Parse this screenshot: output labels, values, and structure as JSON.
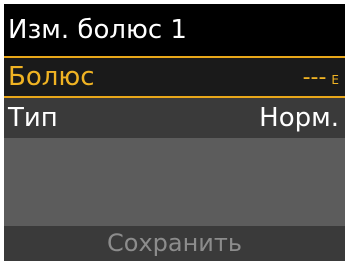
{
  "header": {
    "title": "Изм. болюс 1"
  },
  "rows": [
    {
      "label": "Болюс",
      "value": "---",
      "unit": "Е",
      "selected": true
    },
    {
      "label": "Тип",
      "value": "Норм.",
      "selected": false
    }
  ],
  "footer": {
    "save_label": "Сохранить",
    "enabled": false
  },
  "colors": {
    "accent": "#f0b323",
    "header_bg": "#000000",
    "row_bg": "#3a3a3a",
    "screen_bg": "#5c5c5c",
    "disabled_text": "#8c8c8c"
  }
}
